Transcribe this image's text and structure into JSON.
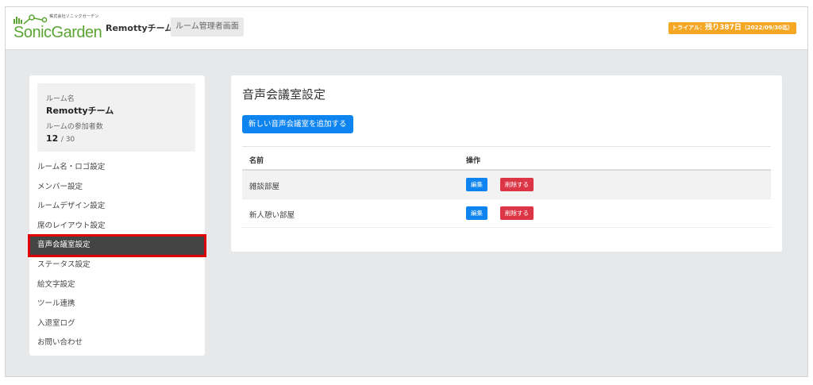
{
  "header": {
    "logo_company": "株式会社ソニックガーデン",
    "logo_word": "SonicGarden",
    "room_title": "Remottyチーム",
    "admin_tag": "ルーム管理者画面",
    "trial_prefix": "トライアル：",
    "trial_main": "残り387日",
    "trial_date": "（2022/09/30迄）",
    "brand_color": "#5aa532",
    "trial_color": "#f5a623"
  },
  "sidebar": {
    "room_name_label": "ルーム名",
    "room_name": "Remottyチーム",
    "members_label": "ルームの参加者数",
    "members_current": "12",
    "members_sep": "/ 30",
    "items": [
      {
        "label": "ルーム名・ロゴ設定"
      },
      {
        "label": "メンバー設定"
      },
      {
        "label": "ルームデザイン設定"
      },
      {
        "label": "席のレイアウト設定"
      },
      {
        "label": "音声会議室設定",
        "active": true
      },
      {
        "label": "ステータス設定"
      },
      {
        "label": "絵文字設定"
      },
      {
        "label": "ツール連携"
      },
      {
        "label": "入退室ログ"
      },
      {
        "label": "お問い合わせ"
      }
    ]
  },
  "main": {
    "title": "音声会議室設定",
    "add_button": "新しい音声会議室を追加する",
    "columns": {
      "name": "名前",
      "actions": "操作"
    },
    "rows": [
      {
        "name": "雑談部屋",
        "edit": "編集",
        "delete": "削除する"
      },
      {
        "name": "新人憩い部屋",
        "edit": "編集",
        "delete": "削除する"
      }
    ],
    "accent_color": "#0d84f0",
    "danger_color": "#dc3545"
  }
}
